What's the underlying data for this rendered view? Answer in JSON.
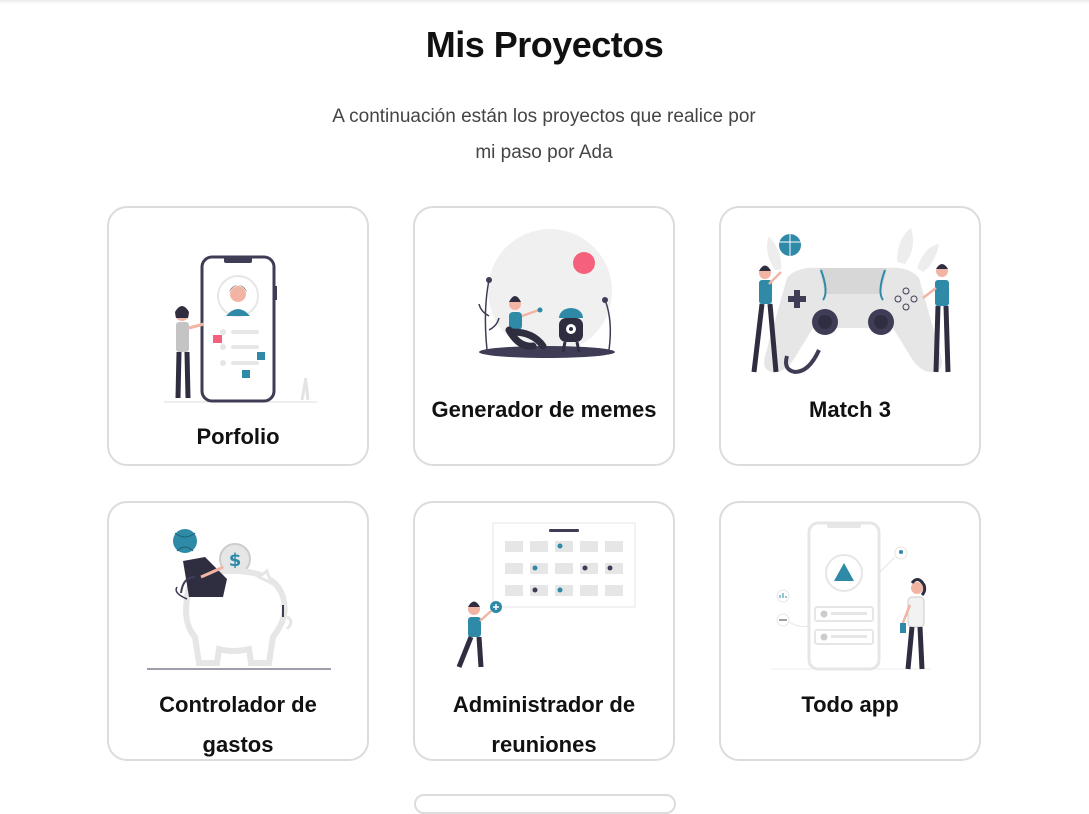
{
  "header": {
    "title": "Mis Proyectos",
    "subtitle_line1": "A continuación están los proyectos que realice por",
    "subtitle_line2": "mi paso por Ada"
  },
  "projects": [
    {
      "title": "Porfolio",
      "icon": "phone-profile-illustration"
    },
    {
      "title": "Generador de memes",
      "icon": "girl-and-robot-illustration"
    },
    {
      "title": "Match 3",
      "icon": "game-controller-illustration"
    },
    {
      "title_line1": "Controlador de",
      "title_line2": "gastos",
      "icon": "piggy-bank-illustration"
    },
    {
      "title_line1": "Administrador de",
      "title_line2": "reuniones",
      "icon": "calendar-illustration"
    },
    {
      "title": "Todo app",
      "icon": "phone-task-illustration"
    }
  ],
  "colors": {
    "accent": "#2f8aa8",
    "pink": "#f5607d",
    "dark": "#3f3d56",
    "light": "#e6e6e6"
  }
}
